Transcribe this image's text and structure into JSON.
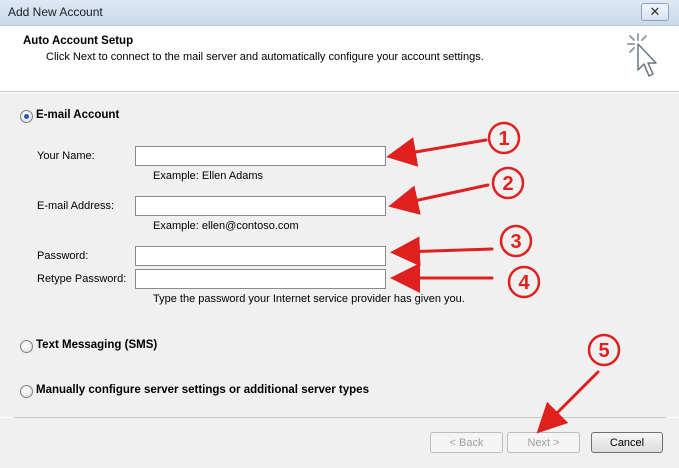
{
  "window": {
    "title": "Add New Account",
    "close_glyph": "✕"
  },
  "header": {
    "title": "Auto Account Setup",
    "subtitle": "Click Next to connect to the mail server and automatically configure your account settings.",
    "icon": "wizard-cursor-icon"
  },
  "options": {
    "email": {
      "label": "E-mail Account",
      "selected": true
    },
    "sms": {
      "label": "Text Messaging (SMS)",
      "selected": false
    },
    "manual": {
      "label": "Manually configure server settings or additional server types",
      "selected": false
    }
  },
  "form": {
    "name_label": "Your Name:",
    "name_value": "",
    "name_hint": "Example: Ellen Adams",
    "email_label": "E-mail Address:",
    "email_value": "",
    "email_hint": "Example: ellen@contoso.com",
    "password_label": "Password:",
    "password_value": "",
    "retype_label": "Retype Password:",
    "retype_value": "",
    "password_hint": "Type the password your Internet service provider has given you."
  },
  "buttons": {
    "back": "< Back",
    "next": "Next >",
    "cancel": "Cancel"
  },
  "annotations": {
    "color": "#e0201f",
    "labels": [
      "1",
      "2",
      "3",
      "4",
      "5"
    ]
  }
}
